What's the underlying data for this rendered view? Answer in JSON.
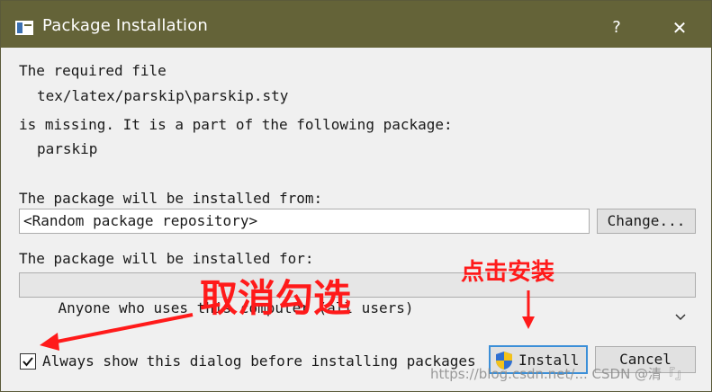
{
  "window": {
    "title": "Package Installation",
    "help_glyph": "?",
    "close_glyph": "✕",
    "titlebar_color": "#646338"
  },
  "message": {
    "line1": "The required file",
    "file_path": "tex/latex/parskip\\parskip.sty",
    "line2": "is missing. It is a part of the following package:",
    "package_name": "parskip"
  },
  "source": {
    "label": "The package will be installed from:",
    "value": "<Random package repository>",
    "change_button": "Change..."
  },
  "target": {
    "label": "The package will be installed for:",
    "selected": "Anyone who uses this computer (all users)"
  },
  "footer": {
    "checkbox_label": "Always show this dialog before installing packages",
    "checkbox_checked": true,
    "install_button": "Install",
    "cancel_button": "Cancel"
  },
  "annotations": {
    "uncheck_note": "取消勾选",
    "install_note": "点击安装",
    "color": "#ff1a1a"
  },
  "watermark": "https://blog.csdn.net/... CSDN @清『』"
}
